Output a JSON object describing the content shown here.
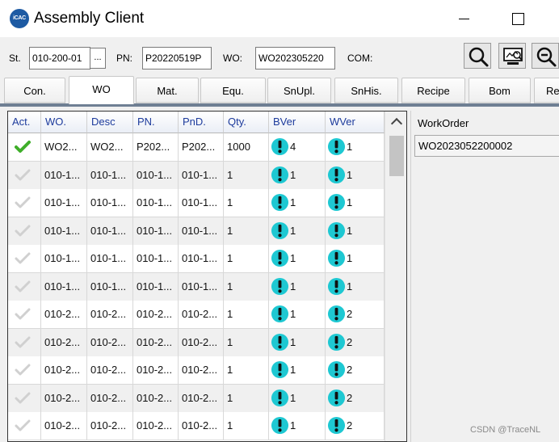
{
  "window": {
    "title": "Assembly Client",
    "logo_text": "iCAC"
  },
  "toolbar": {
    "station_label": "St.",
    "station_value": "010-200-01",
    "station_button": "...",
    "pn_label": "PN:",
    "pn_value": "P20220519P",
    "wo_label": "WO:",
    "wo_value": "WO202305220",
    "com_label": "COM:",
    "buttons": [
      {
        "name": "search-icon"
      },
      {
        "name": "monitor-search-icon"
      },
      {
        "name": "zoom-out-icon"
      }
    ]
  },
  "tabs": [
    {
      "label": "Con."
    },
    {
      "label": "WO",
      "active": true
    },
    {
      "label": "Mat."
    },
    {
      "label": "Equ."
    },
    {
      "label": "SnUpl."
    },
    {
      "label": "SnHis."
    },
    {
      "label": "Recipe"
    },
    {
      "label": "Bom"
    },
    {
      "label": "Re"
    }
  ],
  "grid": {
    "columns": [
      "Act.",
      "WO.",
      "Desc",
      "PN.",
      "PnD.",
      "Qty.",
      "BVer",
      "WVer"
    ],
    "rows": [
      {
        "active": true,
        "wo": "WO2...",
        "desc": "WO2...",
        "pn": "P202...",
        "pnd": "P202...",
        "qty": "1000",
        "bver": "4",
        "wver": "1"
      },
      {
        "active": false,
        "wo": "010-1...",
        "desc": "010-1...",
        "pn": "010-1...",
        "pnd": "010-1...",
        "qty": "1",
        "bver": "1",
        "wver": "1"
      },
      {
        "active": false,
        "wo": "010-1...",
        "desc": "010-1...",
        "pn": "010-1...",
        "pnd": "010-1...",
        "qty": "1",
        "bver": "1",
        "wver": "1"
      },
      {
        "active": false,
        "wo": "010-1...",
        "desc": "010-1...",
        "pn": "010-1...",
        "pnd": "010-1...",
        "qty": "1",
        "bver": "1",
        "wver": "1"
      },
      {
        "active": false,
        "wo": "010-1...",
        "desc": "010-1...",
        "pn": "010-1...",
        "pnd": "010-1...",
        "qty": "1",
        "bver": "1",
        "wver": "1"
      },
      {
        "active": false,
        "wo": "010-1...",
        "desc": "010-1...",
        "pn": "010-1...",
        "pnd": "010-1...",
        "qty": "1",
        "bver": "1",
        "wver": "1"
      },
      {
        "active": false,
        "wo": "010-2...",
        "desc": "010-2...",
        "pn": "010-2...",
        "pnd": "010-2...",
        "qty": "1",
        "bver": "1",
        "wver": "2"
      },
      {
        "active": false,
        "wo": "010-2...",
        "desc": "010-2...",
        "pn": "010-2...",
        "pnd": "010-2...",
        "qty": "1",
        "bver": "1",
        "wver": "2"
      },
      {
        "active": false,
        "wo": "010-2...",
        "desc": "010-2...",
        "pn": "010-2...",
        "pnd": "010-2...",
        "qty": "1",
        "bver": "1",
        "wver": "2"
      },
      {
        "active": false,
        "wo": "010-2...",
        "desc": "010-2...",
        "pn": "010-2...",
        "pnd": "010-2...",
        "qty": "1",
        "bver": "1",
        "wver": "2"
      },
      {
        "active": false,
        "wo": "010-2...",
        "desc": "010-2...",
        "pn": "010-2...",
        "pnd": "010-2...",
        "qty": "1",
        "bver": "1",
        "wver": "2"
      }
    ]
  },
  "workorder_panel": {
    "label": "WorkOrder",
    "value": "WO2023052200002"
  },
  "watermark": "CSDN @TraceNL",
  "colors": {
    "accent_teal": "#1ec8d2",
    "check_green": "#3fae2a",
    "tab_underline": "#6f7f93",
    "header_text": "#1d3b9c"
  }
}
